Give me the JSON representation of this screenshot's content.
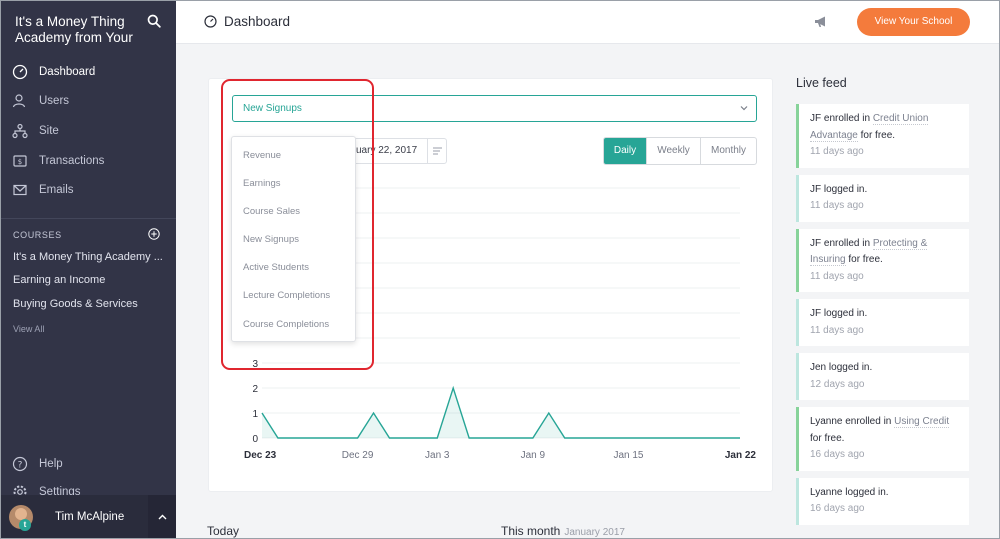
{
  "sidebar": {
    "brand": "It's a Money Thing Academy from Your",
    "nav": [
      {
        "label": "Dashboard",
        "icon": "dashboard-icon",
        "active": true
      },
      {
        "label": "Users",
        "icon": "users-icon"
      },
      {
        "label": "Site",
        "icon": "site-icon"
      },
      {
        "label": "Transactions",
        "icon": "transactions-icon"
      },
      {
        "label": "Emails",
        "icon": "emails-icon"
      }
    ],
    "courses_heading": "COURSES",
    "courses": [
      "It's a Money Thing Academy ...",
      "Earning an Income",
      "Buying Goods & Services"
    ],
    "view_all": "View All",
    "help": "Help",
    "settings": "Settings",
    "user_name": "Tim McAlpine",
    "avatar_letter": "t"
  },
  "topbar": {
    "title": "Dashboard",
    "school_button": "View Your School"
  },
  "main": {
    "metric_selected": "New Signups",
    "metric_options": [
      "Revenue",
      "Earnings",
      "Course Sales",
      "New Signups",
      "Active Students",
      "Lecture Completions",
      "Course Completions"
    ],
    "date_range_visible": "uary 22, 2017",
    "periods": [
      {
        "label": "Daily",
        "active": true
      },
      {
        "label": "Weekly",
        "active": false
      },
      {
        "label": "Monthly",
        "active": false
      }
    ],
    "today_label": "Today",
    "this_month_label": "This month",
    "this_month_sub": "January 2017"
  },
  "chart_data": {
    "type": "area",
    "y_ticks": [
      "0",
      "1",
      "2",
      "3"
    ],
    "x_ticks": [
      "Dec 23",
      "Dec 29",
      "Jan 3",
      "Jan 9",
      "Jan 15",
      "Jan 22"
    ],
    "x": [
      "Dec 23",
      "Dec 24",
      "Dec 25",
      "Dec 26",
      "Dec 27",
      "Dec 28",
      "Dec 29",
      "Dec 30",
      "Dec 31",
      "Jan 1",
      "Jan 2",
      "Jan 3",
      "Jan 4",
      "Jan 5",
      "Jan 6",
      "Jan 7",
      "Jan 8",
      "Jan 9",
      "Jan 10",
      "Jan 11",
      "Jan 12",
      "Jan 13",
      "Jan 14",
      "Jan 15",
      "Jan 16",
      "Jan 17",
      "Jan 18",
      "Jan 19",
      "Jan 20",
      "Jan 21",
      "Jan 22"
    ],
    "values": [
      1,
      0,
      0,
      0,
      0,
      0,
      0,
      1,
      0,
      0,
      0,
      0,
      2,
      0,
      0,
      0,
      0,
      0,
      1,
      0,
      0,
      0,
      0,
      0,
      0,
      0,
      0,
      0,
      0,
      0,
      0
    ],
    "color": "#27a596"
  },
  "feed": {
    "title": "Live feed",
    "items": [
      {
        "actor": "JF",
        "action": "enrolled in",
        "course": "Credit Union Advantage",
        "suffix": "for free.",
        "time": "11 days ago"
      },
      {
        "actor": "JF",
        "action": "logged in.",
        "course": "",
        "suffix": "",
        "time": "11 days ago"
      },
      {
        "actor": "JF",
        "action": "enrolled in",
        "course": "Protecting & Insuring",
        "suffix": "for free.",
        "time": "11 days ago"
      },
      {
        "actor": "JF",
        "action": "logged in.",
        "course": "",
        "suffix": "",
        "time": "11 days ago"
      },
      {
        "actor": "Jen",
        "action": "logged in.",
        "course": "",
        "suffix": "",
        "time": "12 days ago"
      },
      {
        "actor": "Lyanne",
        "action": "enrolled in",
        "course": "Using Credit",
        "suffix": "for free.",
        "time": "16 days ago"
      },
      {
        "actor": "Lyanne",
        "action": "logged in.",
        "course": "",
        "suffix": "",
        "time": "16 days ago"
      }
    ]
  }
}
